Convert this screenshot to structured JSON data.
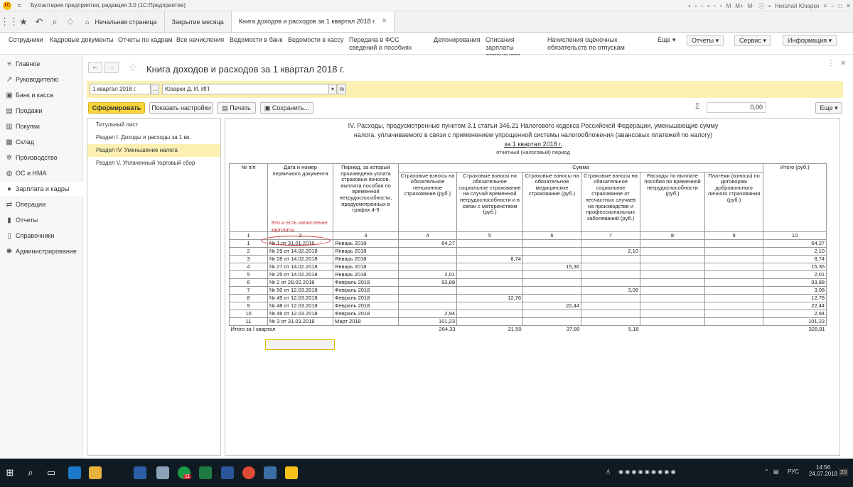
{
  "window": {
    "title": "Бухгалтерия предприятия, редакция 3.0 (1С:Предприятие)",
    "user": "Николай Юзарки",
    "controls": [
      "M",
      "M+",
      "M-"
    ]
  },
  "tabs": [
    {
      "label": "Начальная страница"
    },
    {
      "label": "Закрытие месяца"
    },
    {
      "label": "Книга доходов и расходов за 1 квартал 2018 г."
    }
  ],
  "menu": {
    "items": [
      {
        "label": "Сотрудники"
      },
      {
        "label": "Кадровые документы"
      },
      {
        "label": "Отчеты по кадрам"
      },
      {
        "label": "Все начисления"
      },
      {
        "label": "Ведомости в банк"
      },
      {
        "label": "Ведомости в кассу"
      },
      {
        "label": "Передача в ФСС сведений о пособиях"
      },
      {
        "label": "Депонирования"
      },
      {
        "label": "Списания зарплаты депонентов"
      },
      {
        "label": "Начисления оценочных обязательств по отпускам"
      }
    ],
    "more": "Еще",
    "reports": "Отчеты",
    "service": "Сервис",
    "info": "Информация"
  },
  "sidebar": [
    {
      "label": "Главное"
    },
    {
      "label": "Руководителю"
    },
    {
      "label": "Банк и касса"
    },
    {
      "label": "Продажи"
    },
    {
      "label": "Покупки"
    },
    {
      "label": "Склад"
    },
    {
      "label": "Производство"
    },
    {
      "label": "ОС и НМА"
    },
    {
      "label": "Зарплата и кадры"
    },
    {
      "label": "Операции"
    },
    {
      "label": "Отчеты"
    },
    {
      "label": "Справочники"
    },
    {
      "label": "Администрирование"
    }
  ],
  "doc": {
    "title": "Книга доходов и расходов за 1 квартал 2018 г.",
    "period": "1 квартал 2018 г.",
    "period_btn": "...",
    "org": "Юзарки Д. И. ИП",
    "btn_generate": "Сформировать",
    "btn_settings": "Показать настройки",
    "btn_print": "Печать",
    "btn_save": "Сохранить...",
    "sum_value": "0,00",
    "sum_symbol": "Σ",
    "more": "Еще"
  },
  "sections": [
    {
      "label": "Титульный лист"
    },
    {
      "label": "Раздел I. Доходы и расходы за 1 кв."
    },
    {
      "label": "Раздел IV. Уменьшение налога"
    },
    {
      "label": "Раздел V. Уплаченный торговый сбор"
    }
  ],
  "report": {
    "header_line1": "IV. Расходы, предусмотренные пунктом 3.1 статьи 346.21 Налогового кодекса Российской Федерации, уменьшающие сумму",
    "header_line2": "налога, уплачиваемого в связи с применением упрощенной системы налогообложения (авансовых платежей по налогу)",
    "period": "за 1 квартал 2018 г.",
    "period_caption": "отчетный (налоговый) период",
    "note": "Это и есть начисление зарплаты",
    "col_headers": {
      "num": "№ п/п",
      "doc": "Дата и номер первичного документа",
      "period": "Период, за который произведена уплата страховых взносов, выплата пособия по временной нетрудоспособности, предусмотренных в графах 4-9",
      "sum": "Сумма",
      "c4": "Страховые взносы на обязательное пенсионное страхование (руб.)",
      "c5": "Страховые взносы на обязательное социальное страхование на случай временной нетрудоспособности и в связи с материнством (руб.)",
      "c6": "Страховые взносы на обязательное медицинское страхование (руб.)",
      "c7": "Страховые взносы на обязательное социальное страхование от несчастных случаев на производстве и профессиональных заболеваний (руб.)",
      "c8": "Расходы по выплате пособия по временной нетрудоспособности (руб.)",
      "c9": "Платежи (взносы) по договорам добровольного личного страхования (руб.)",
      "c10": "Итого (руб.)"
    },
    "col_numbers": [
      "1",
      "2",
      "3",
      "4",
      "5",
      "6",
      "7",
      "8",
      "9",
      "10"
    ],
    "rows": [
      {
        "n": "1",
        "doc": "№ 1 от 31.01.2018",
        "period": "Январь 2018",
        "c4": "64,27",
        "c5": "",
        "c6": "",
        "c7": "",
        "c8": "",
        "c9": "",
        "c10": "64,27"
      },
      {
        "n": "2",
        "doc": "№ 29 от 14.02.2018",
        "period": "Январь 2018",
        "c4": "",
        "c5": "",
        "c6": "",
        "c7": "2,10",
        "c8": "",
        "c9": "",
        "c10": "2,10"
      },
      {
        "n": "3",
        "doc": "№ 28 от 14.02.2018",
        "period": "Январь 2018",
        "c4": "",
        "c5": "8,74",
        "c6": "",
        "c7": "",
        "c8": "",
        "c9": "",
        "c10": "8,74"
      },
      {
        "n": "4",
        "doc": "№ 27 от 14.02.2018",
        "period": "Январь 2018",
        "c4": "",
        "c5": "",
        "c6": "15,36",
        "c7": "",
        "c8": "",
        "c9": "",
        "c10": "15,36"
      },
      {
        "n": "5",
        "doc": "№ 25 от 14.02.2018",
        "period": "Январь 2018",
        "c4": "2,01",
        "c5": "",
        "c6": "",
        "c7": "",
        "c8": "",
        "c9": "",
        "c10": "2,01"
      },
      {
        "n": "6",
        "doc": "№ 2 от 28.02.2018",
        "period": "Февраль 2018",
        "c4": "93,88",
        "c5": "",
        "c6": "",
        "c7": "",
        "c8": "",
        "c9": "",
        "c10": "93,88"
      },
      {
        "n": "7",
        "doc": "№ 50 от 12.03.2018",
        "period": "Февраль 2018",
        "c4": "",
        "c5": "",
        "c6": "",
        "c7": "3,08",
        "c8": "",
        "c9": "",
        "c10": "3,08"
      },
      {
        "n": "8",
        "doc": "№ 49 от 12.03.2018",
        "period": "Февраль 2018",
        "c4": "",
        "c5": "12,76",
        "c6": "",
        "c7": "",
        "c8": "",
        "c9": "",
        "c10": "12,76"
      },
      {
        "n": "9",
        "doc": "№ 48 от 12.03.2018",
        "period": "Февраль 2018",
        "c4": "",
        "c5": "",
        "c6": "22,44",
        "c7": "",
        "c8": "",
        "c9": "",
        "c10": "22,44"
      },
      {
        "n": "10",
        "doc": "№ 46 от 12.03.2018",
        "period": "Февраль 2018",
        "c4": "2,94",
        "c5": "",
        "c6": "",
        "c7": "",
        "c8": "",
        "c9": "",
        "c10": "2,94"
      },
      {
        "n": "11",
        "doc": "№ 3 от 31.03.2018",
        "period": "Март 2018",
        "c4": "101,23",
        "c5": "",
        "c6": "",
        "c7": "",
        "c8": "",
        "c9": "",
        "c10": "101,23"
      }
    ],
    "total": {
      "label": "Итого за I квартал",
      "c4": "264,33",
      "c5": "21,50",
      "c6": "37,80",
      "c7": "5,18",
      "c8": "",
      "c9": "",
      "c10": "328,81"
    }
  },
  "taskbar": {
    "lang": "РУС",
    "time": "14:56",
    "date": "24.07.2018",
    "notif": "20",
    "badge": "11"
  }
}
